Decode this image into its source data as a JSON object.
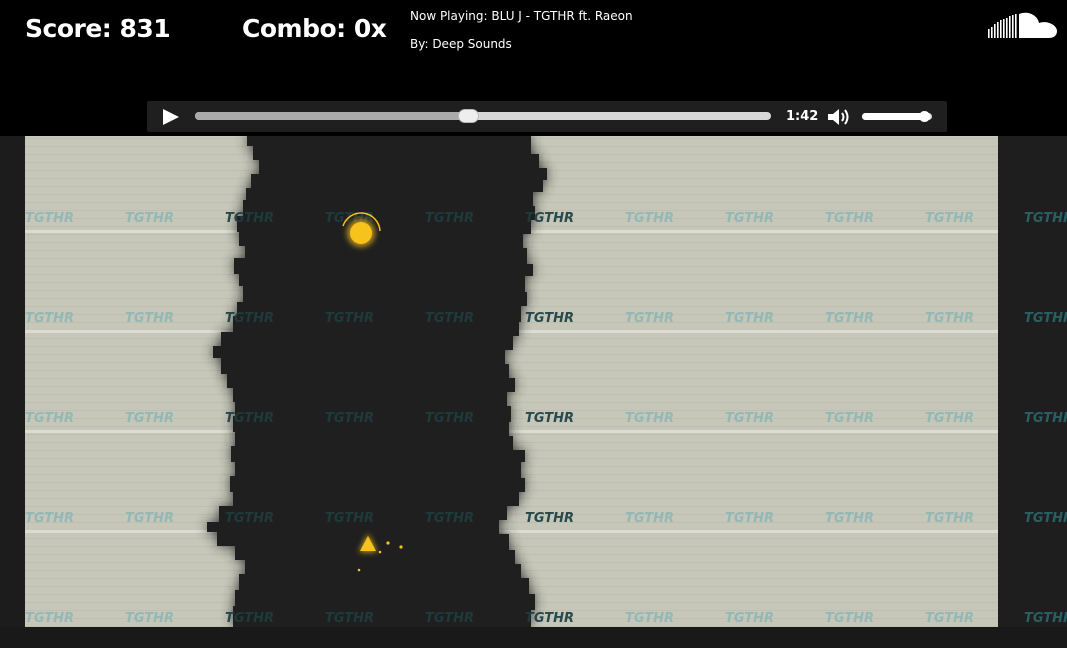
{
  "hud": {
    "score_text": "Score: 831",
    "combo_text": "Combo: 0x",
    "now_playing": "Now Playing: BLU J - TGTHR ft. Raeon",
    "artist": "By: Deep Sounds",
    "logo_icon": "soundcloud-icon"
  },
  "player": {
    "play_icon": "play-icon",
    "time": "1:42",
    "progress": 0.474,
    "volume_icon": "volume-icon",
    "volume": 0.89
  },
  "game": {
    "watermark": "TGTHR",
    "colors": {
      "wall": "#c6c7b9",
      "path": "#1f1f1f",
      "accent": "#f7c21c",
      "watermark": "#84b3b5"
    },
    "orb_icon": "glowing-orb",
    "ship_icon": "triangle-ship"
  }
}
